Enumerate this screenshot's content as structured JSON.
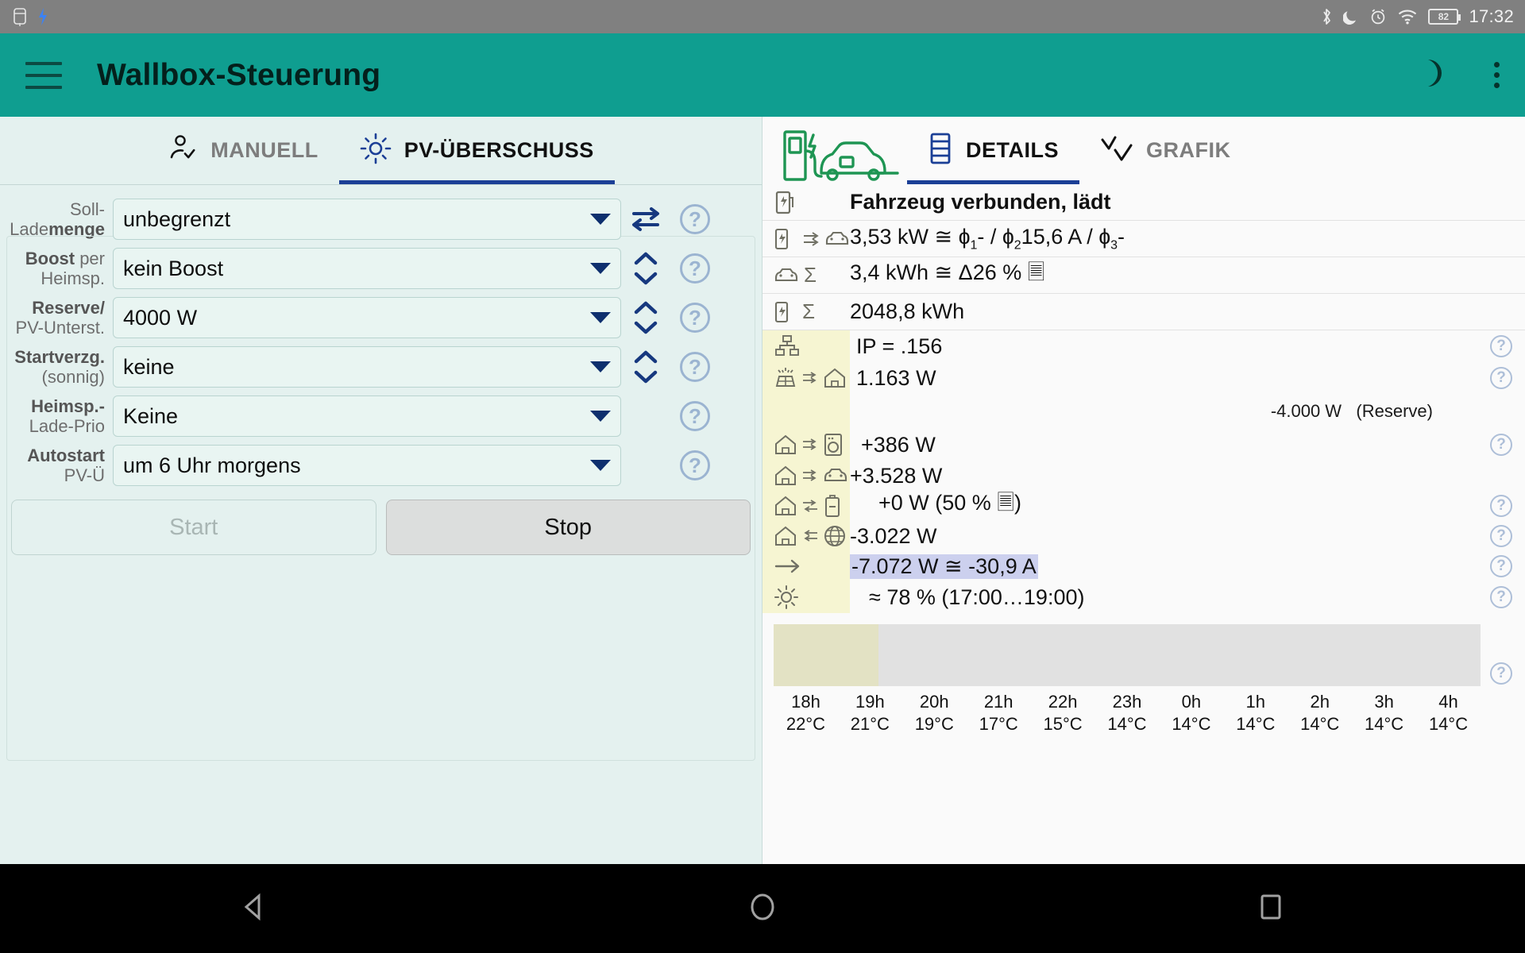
{
  "statusbar": {
    "time": "17:32",
    "battery_level": "82",
    "icons": [
      "car-icon",
      "charging-bolt-icon",
      "bluetooth-icon",
      "do-not-disturb-moon-icon",
      "alarm-clock-icon",
      "wifi-icon",
      "battery-icon"
    ]
  },
  "appbar": {
    "title": "Wallbox-Steuerung",
    "menu_icon": "hamburger-menu-icon",
    "night_icon": "moon-icon",
    "overflow_icon": "kebab-menu-icon"
  },
  "left_tabs": [
    {
      "label": "MANUELL",
      "icon": "person-check-icon",
      "active": false
    },
    {
      "label": "PV-ÜBERSCHUSS",
      "icon": "sun-icon",
      "active": true
    }
  ],
  "form": {
    "rows": [
      {
        "label_a": "Soll-",
        "label_b": "Lade",
        "label_c": "menge",
        "value": "unbegrenzt",
        "spinner": "left-right-arrows-icon",
        "help": true
      },
      {
        "label_a": "Boost",
        "label_b": " per",
        "label_c": "Heimsp.",
        "value": "kein Boost",
        "spinner": "up-down-chevrons-icon",
        "help": true
      },
      {
        "label_a": "Reserve/",
        "label_b": "",
        "label_c": "PV-Unterst.",
        "value": "4000 W",
        "spinner": "up-down-chevrons-icon",
        "help": true
      },
      {
        "label_a": "Startverzg.",
        "label_b": "",
        "label_c": "(sonnig)",
        "value": "keine",
        "spinner": "up-down-chevrons-icon",
        "help": true
      },
      {
        "label_a": "Heimsp.-",
        "label_b": "",
        "label_c": "Lade-Prio",
        "value": "Keine",
        "spinner": "",
        "help": true
      },
      {
        "label_a": "Autostart",
        "label_b": "",
        "label_c": "PV-Ü",
        "value": "um 6 Uhr morgens",
        "spinner": "",
        "help": true
      }
    ]
  },
  "buttons": {
    "start": "Start",
    "stop": "Stop"
  },
  "right_tabs": [
    {
      "label": "DETAILS",
      "icon": "list-table-icon",
      "active": true
    },
    {
      "label": "GRAFIK",
      "icon": "chart-line-icon",
      "active": false
    }
  ],
  "details": {
    "status": "Fahrzeug verbunden, lädt",
    "rows": [
      {
        "value": "3,53 kW ≅ ɸ",
        "value2": "- / ɸ",
        "value3": "15,6 A / ɸ",
        "value4": "-",
        "s1": "1",
        "s2": "2",
        "s3": "3"
      },
      {
        "value": "3,4 kWh ≅ Δ26 % 🗏"
      },
      {
        "value": "2048,8 kWh"
      }
    ],
    "ip": "IP = .156",
    "pv_to_house": "1.163 W",
    "reserve_value": "-4.000 W",
    "reserve_label": "(Reserve)",
    "house_to_appliance": "+386 W",
    "house_to_car": "+3.528 W",
    "house_battery": "+0 W (50 % 🗏)",
    "house_from_grid": "-3.022 W",
    "total": "-7.072 W ≅ -30,9 A",
    "sun_forecast": "≈ 78 % (17:00…19:00)"
  },
  "forecast": {
    "hours": [
      "18h",
      "19h",
      "20h",
      "21h",
      "22h",
      "23h",
      "0h",
      "1h",
      "2h",
      "3h",
      "4h"
    ],
    "temps": [
      "22°C",
      "21°C",
      "19°C",
      "17°C",
      "15°C",
      "14°C",
      "14°C",
      "14°C",
      "14°C",
      "14°C",
      "14°C"
    ]
  },
  "navbar": {
    "back": "back-triangle-icon",
    "home": "home-circle-icon",
    "recents": "recents-square-icon"
  },
  "colors": {
    "appbar": "#0f9e90",
    "accent_blue": "#1b3f96",
    "panel_bg": "#e4f1ef",
    "highlight_yellow": "#f6f5d2",
    "highlight_blue": "#ccd0ee",
    "ev_green": "#1e9553"
  }
}
